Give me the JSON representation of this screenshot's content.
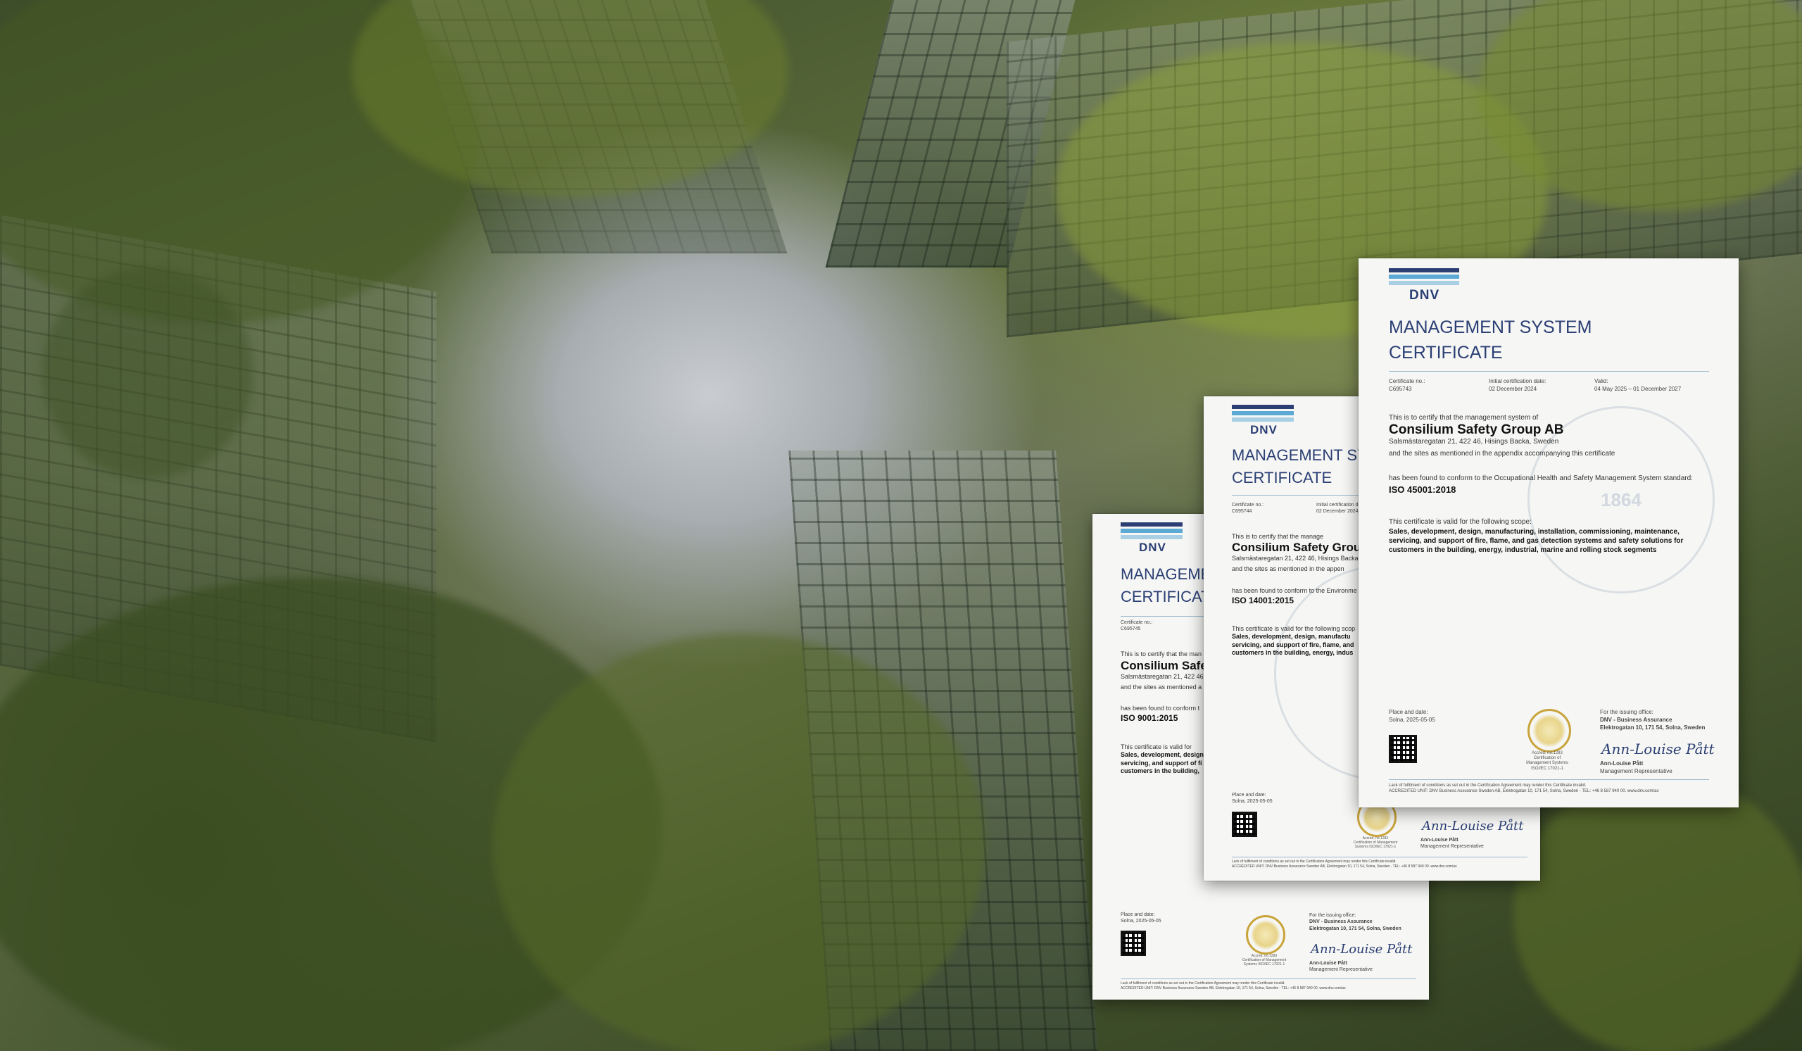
{
  "certificates": [
    {
      "logo": "DNV",
      "title_line1": "MANAGEMENT SYSTEM",
      "title_line2": "CERTIFICATE",
      "cert_no_label": "Certificate no.:",
      "cert_no": "C695743",
      "initial_label": "Initial certification date:",
      "initial_date": "02 December 2024",
      "valid_label": "Valid:",
      "valid_range": "04 May 2025 – 01 December 2027",
      "intro": "This is to certify that the management system of",
      "company": "Consilium Safety Group AB",
      "address": "Salsmästaregatan 21, 422 46, Hisings Backa, Sweden",
      "sites": "and the sites as mentioned in the appendix accompanying this certificate",
      "conform": "has been found to conform to the Occupational Health and Safety Management System standard:",
      "standard": "ISO 45001:2018",
      "scope_intro": "This certificate is valid for the following scope:",
      "scope": "Sales, development, design, manufacturing, installation, commissioning, maintenance, servicing, and support of fire, flame, and gas detection systems and safety solutions for customers in the building, energy, industrial, marine and rolling stock segments",
      "place_label": "Place and date:",
      "place": "Solna, 2025-05-05",
      "issuing_label": "For the issuing office:",
      "issuing_office": "DNV - Business Assurance",
      "issuing_address": "Elektrogatan 10, 171 54, Solna, Sweden",
      "signatory": "Ann-Louise Pått",
      "signatory_role": "Management Representative",
      "seal_text": "1864",
      "footer_1": "Lack of fulfilment of conditions as set out in the Certification Agreement may render this Certificate invalid.",
      "footer_2": "ACCREDITED UNIT: DNV Business Assurance Sweden AB, Elektrogatan 10, 171 54, Solna, Sweden - TEL: +46 8 587 940 00. www.dnv.com/as"
    },
    {
      "logo": "DNV",
      "title_line1": "MANAGEMENT SY",
      "title_line2": "CERTIFICATE",
      "cert_no_label": "Certificate no.:",
      "cert_no": "C695744",
      "initial_label": "Initial certification date:",
      "initial_date": "02 December 2024",
      "intro": "This is to certify that the manage",
      "company": "Consilium Safety Grou",
      "address": "Salsmästaregatan 21, 422 46, Hisings Backa",
      "sites": "and the sites as mentioned in the appen",
      "conform": "has been found to conform to the Environme",
      "standard": "ISO 14001:2015",
      "scope_intro": "This certificate is valid for the following scop",
      "scope": "Sales, development, design, manufactu servicing, and support of fire, flame, and customers in the building, energy, indus",
      "place_label": "Place and date:",
      "place": "Solna, 2025-05-05",
      "signatory": "Ann-Louise Pått",
      "signatory_role": "Management Representative",
      "footer_1": "Lack of fulfilment of conditions as set out in the Certification Agreement may render this Certificate invalid.",
      "footer_2": "ACCREDITED UNIT: DNV Business Assurance Sweden AB, Elektrogatan 10, 171 54, Solna, Sweden - TEL: +46 8 587 940 00. www.dnv.com/as"
    },
    {
      "logo": "DNV",
      "title_line1": "MANAGEMEN",
      "title_line2": "CERTIFICATE",
      "cert_no_label": "Certificate no.:",
      "cert_no": "C695745",
      "intro": "This is to certify that the man",
      "company": "Consilium Safe",
      "address": "Salsmästaregatan 21, 422 46",
      "sites": "and the sites as mentioned a",
      "conform": "has been found to conform t",
      "standard": "ISO 9001:2015",
      "scope_intro": "This certificate is valid for",
      "scope": "Sales, development, design servicing, and support of fi customers in the building,",
      "place_label": "Place and date:",
      "place": "Solna, 2025-05-05",
      "issuing_label": "For the issuing office:",
      "issuing_office": "DNV - Business Assurance",
      "issuing_address": "Elektrogatan 10, 171 54, Solna, Sweden",
      "signatory": "Ann-Louise Pått",
      "signatory_role": "Management Representative",
      "footer_1": "Lack of fulfilment of conditions as set out in the Certification Agreement may render this Certificate invalid.",
      "footer_2": "ACCREDITED UNIT: DNV Business Assurance Sweden AB, Elektrogatan 10, 171 54, Solna, Sweden - TEL: +46 8 587 940 00. www.dnv.com/as"
    }
  ],
  "badge": {
    "ring_text": "SWEDAC ACKREDITERING",
    "caption": "Accred. no.1283 Certification of Management Systems ISO/IEC 17021-1"
  },
  "colors": {
    "dnv_navy": "#2b3f74",
    "dnv_blue": "#5da9d6",
    "dnv_light_blue": "#a8cfe3",
    "foliage_green": "#59693a"
  }
}
